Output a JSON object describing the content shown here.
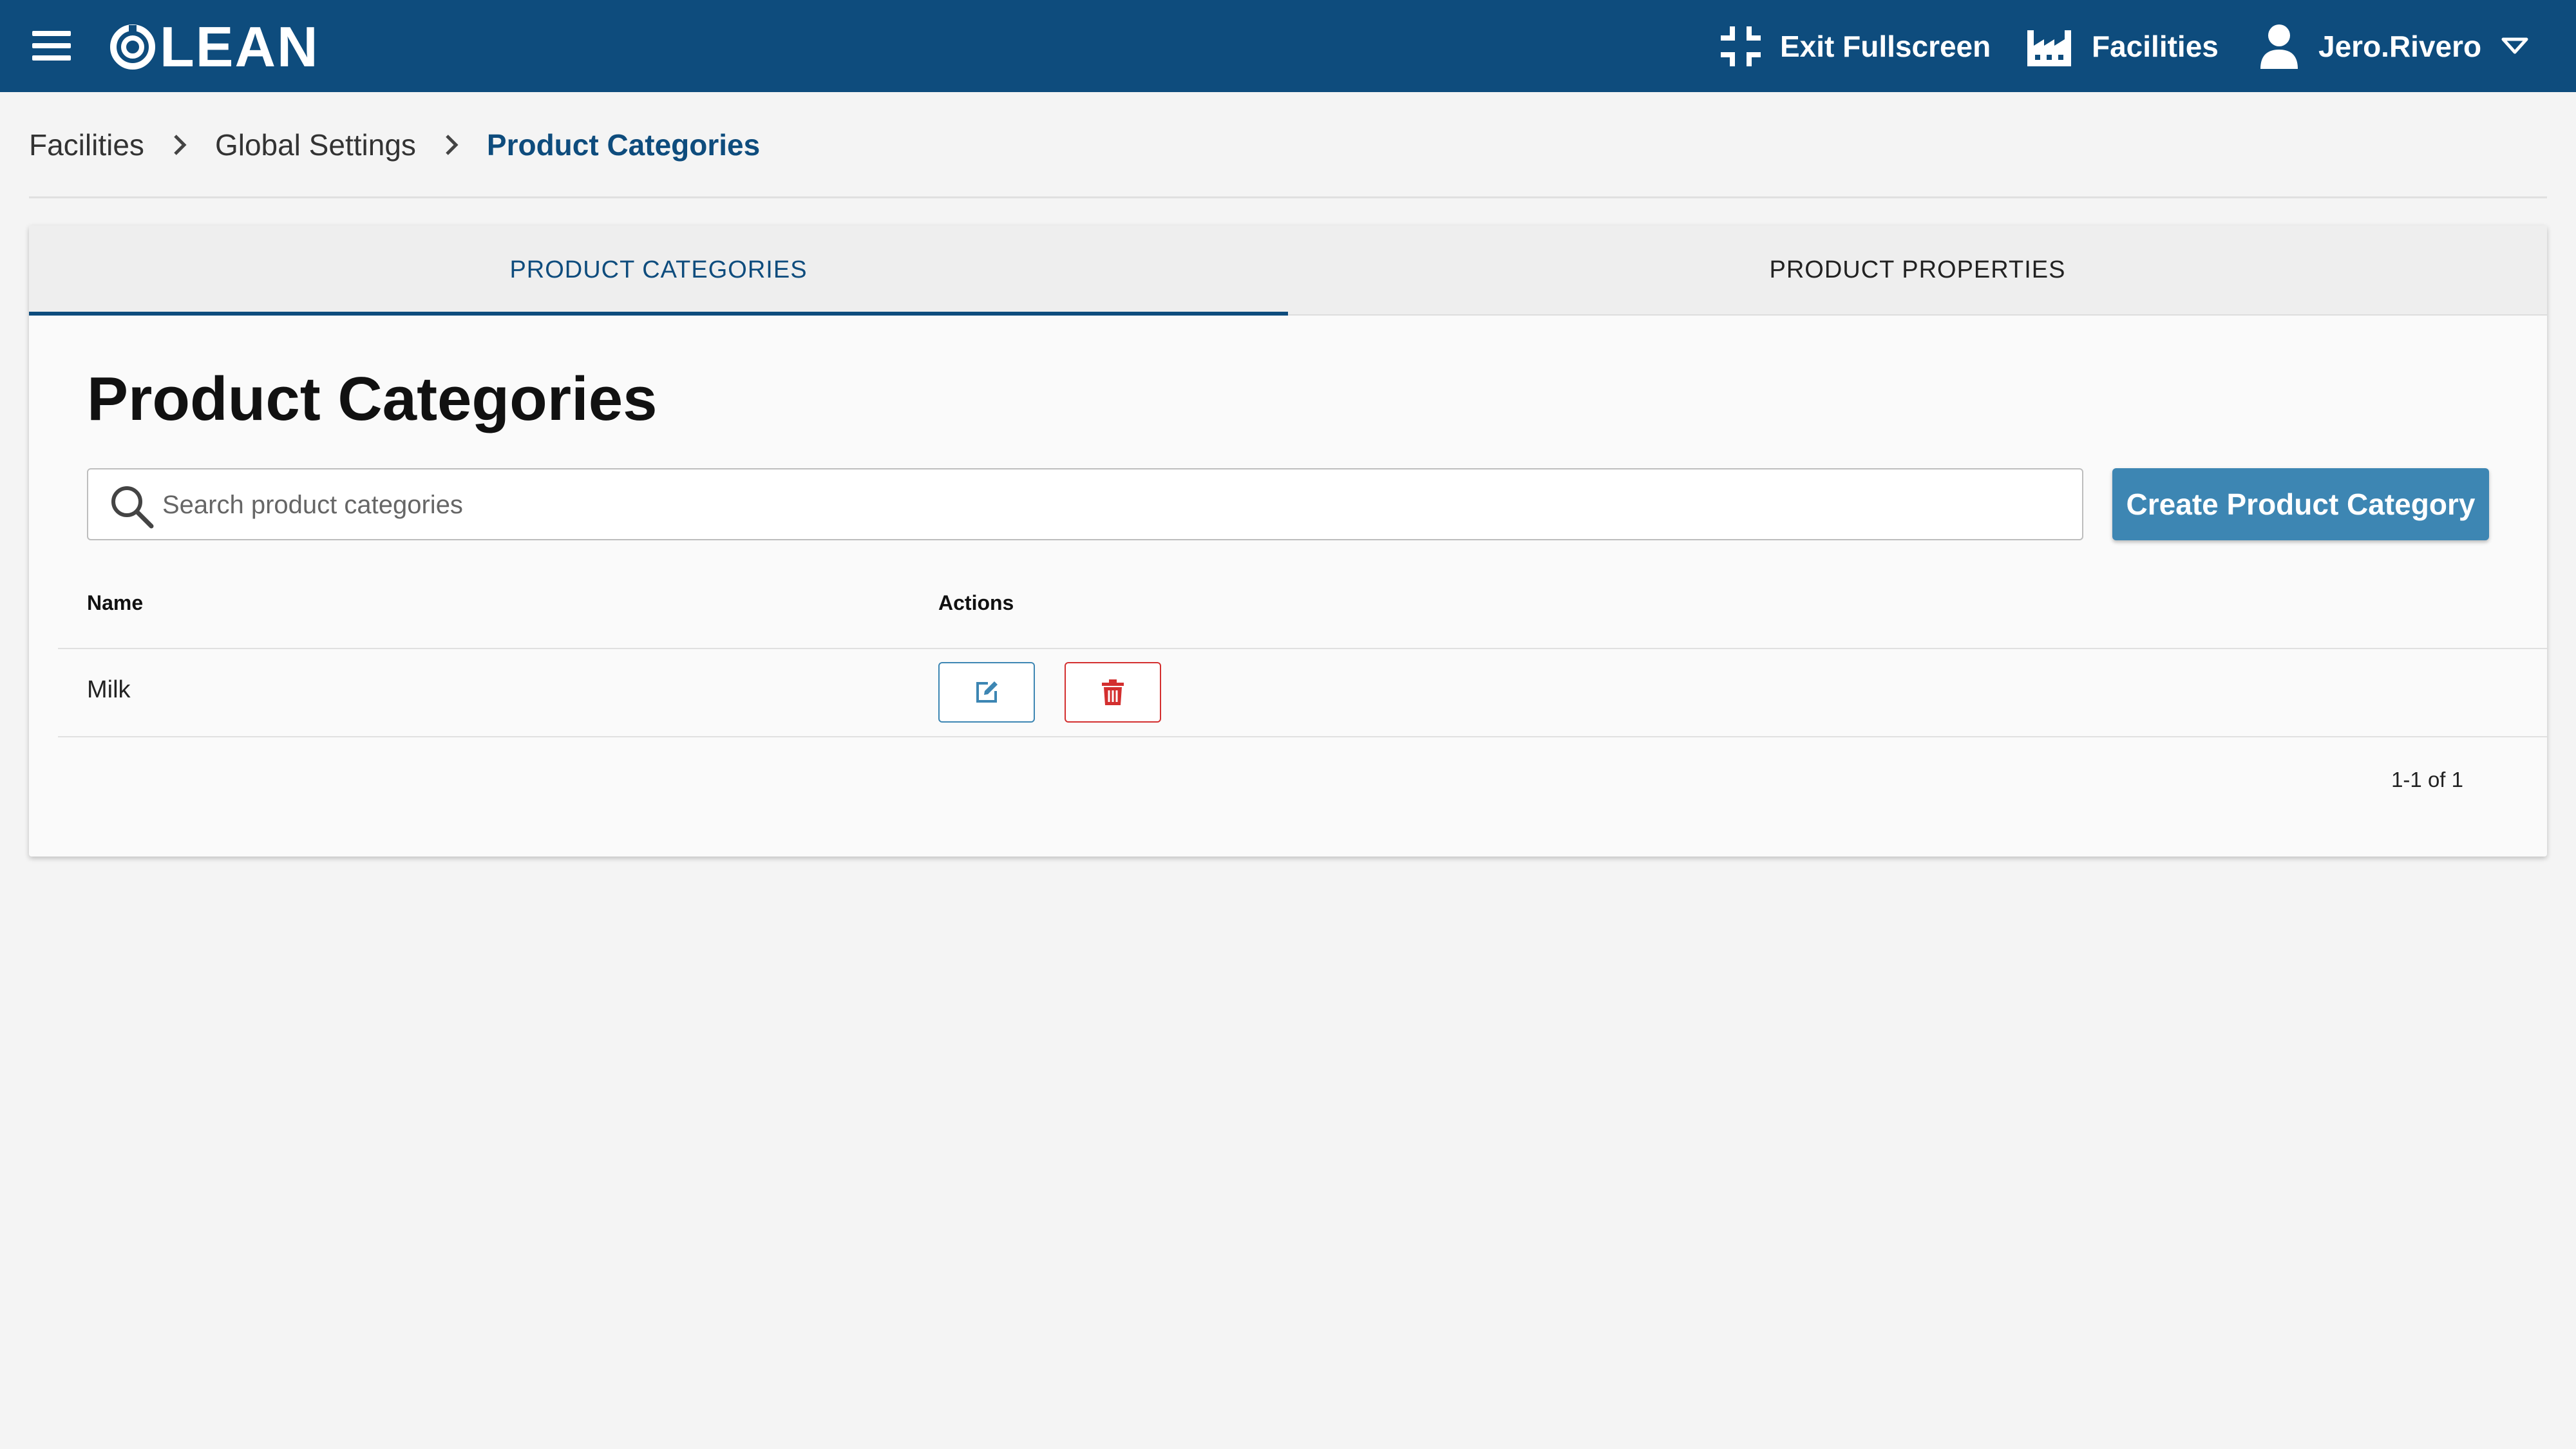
{
  "app": {
    "brand": "LEAN",
    "colors": {
      "primary": "#0e4c7d",
      "button": "#3d86b3",
      "danger": "#d32f2f",
      "background": "#f4f4f4"
    }
  },
  "header": {
    "menu_icon": "hamburger-menu-icon",
    "exit_fullscreen_label": "Exit Fullscreen",
    "exit_fullscreen_icon": "compress-icon",
    "facilities_label": "Facilities",
    "facilities_icon": "factory-icon",
    "user_label": "Jero.Rivero",
    "user_icon": "user-icon",
    "user_dropdown_icon": "chevron-down-icon"
  },
  "breadcrumb": {
    "items": [
      "Facilities",
      "Global Settings",
      "Product Categories"
    ],
    "separator_icon": "chevron-right-icon"
  },
  "tabs": [
    {
      "label": "PRODUCT CATEGORIES",
      "active": true
    },
    {
      "label": "PRODUCT PROPERTIES",
      "active": false
    }
  ],
  "main": {
    "title": "Product Categories",
    "search": {
      "placeholder": "Search product categories",
      "value": ""
    },
    "create_button_label": "Create Product Category"
  },
  "table": {
    "columns": [
      "Name",
      "Actions"
    ],
    "rows": [
      {
        "name": "Milk",
        "actions": [
          "edit-icon",
          "trash-icon"
        ]
      }
    ],
    "pagination": "1-1 of 1"
  }
}
